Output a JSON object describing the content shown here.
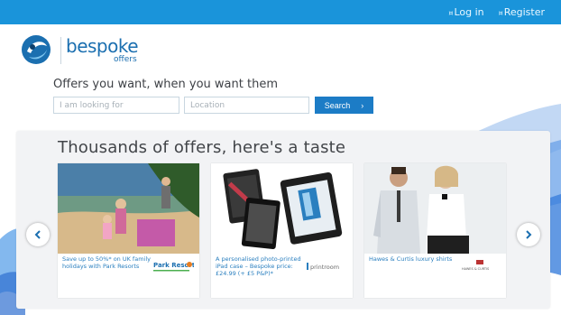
{
  "header": {
    "login": "Log in",
    "register": "Register",
    "login_prefix": "¤",
    "register_prefix": "¤"
  },
  "brand": {
    "name": "bespoke",
    "sub": "offers"
  },
  "hero": {
    "tagline": "Offers you want, when you want them",
    "search_placeholder": "I am looking for",
    "location_placeholder": "Location",
    "search_label": "Search",
    "search_arrow": "›"
  },
  "offers": {
    "title": "Thousands of offers, here's a taste",
    "items": [
      {
        "description": "Save up to 50%* on UK family holidays with Park Resorts",
        "brand": "Park Resorts"
      },
      {
        "description": "A personalised photo-printed iPad case – Bespoke price: £24.99 (+ £5 P&P)*",
        "brand": "printroom"
      },
      {
        "description": "Hawes & Curtis luxury shirts",
        "brand": "HAWES & CURTIS"
      }
    ],
    "prev_icon": "chevron-left-icon",
    "next_icon": "chevron-right-icon"
  },
  "colors": {
    "topbar": "#1a94da",
    "brand_blue": "#1b6fb0",
    "link_blue": "#2a7fbf",
    "button": "#1c7cc6"
  }
}
